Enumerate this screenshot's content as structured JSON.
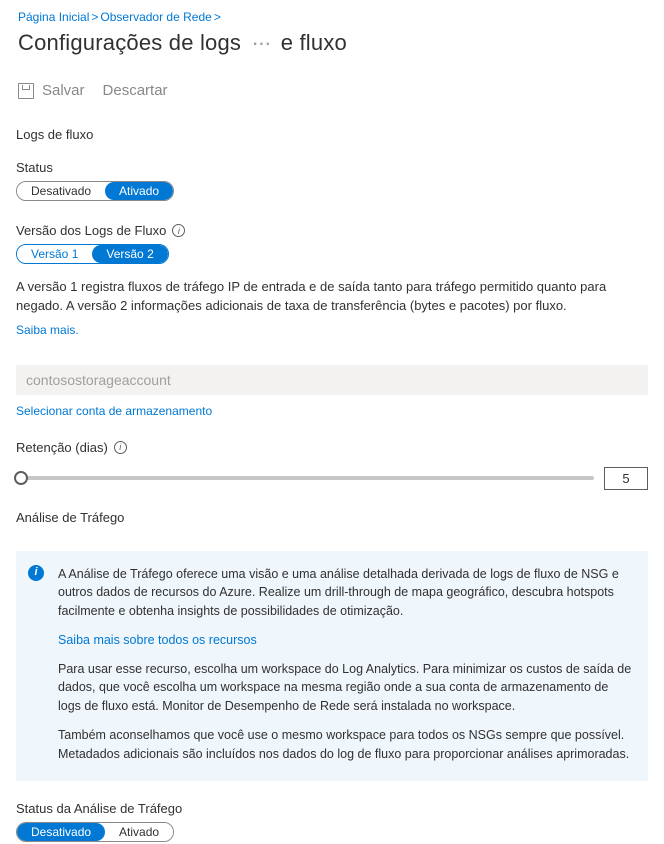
{
  "breadcrumb": {
    "home": "Página Inicial",
    "watcher": "Observador de Rede"
  },
  "pageTitle": {
    "prefix": "Configurações de logs",
    "suffix": "e fluxo"
  },
  "toolbar": {
    "save": "Salvar",
    "discard": "Descartar"
  },
  "sections": {
    "flowLogs": "Logs de fluxo",
    "trafficAnalysis": "Análise de Tráfego"
  },
  "status": {
    "label": "Status",
    "off": "Desativado",
    "on": "Ativado"
  },
  "version": {
    "label": "Versão dos Logs de Fluxo",
    "v1": "Versão 1",
    "v2": "Versão 2",
    "desc": "A versão 1 registra fluxos de tráfego IP de entrada e de saída tanto para tráfego permitido quanto para negado. A versão 2 informações adicionais de taxa de transferência (bytes e pacotes) por fluxo.",
    "learnMore": "Saiba mais."
  },
  "storage": {
    "value": "contosostorageaccount",
    "selectLink": "Selecionar conta de armazenamento"
  },
  "retention": {
    "label": "Retenção (dias)",
    "value": "5"
  },
  "trafficPanel": {
    "p1": "A Análise de Tráfego oferece uma visão e uma análise detalhada derivada de logs de fluxo de NSG e outros dados de recursos do Azure. Realize um drill-through de mapa geográfico, descubra hotspots facilmente e obtenha insights de possibilidades de otimização.",
    "link": "Saiba mais sobre todos os recursos",
    "p2": "Para usar esse recurso, escolha um workspace do Log Analytics. Para minimizar os custos de saída de dados, que você escolha um workspace na mesma região onde a sua conta de armazenamento de logs de fluxo está. Monitor de Desempenho de Rede será instalada no workspace.",
    "p3": "Também aconselhamos que você use o mesmo workspace para todos os NSGs sempre que possível. Metadados adicionais são incluídos nos dados do log de fluxo para proporcionar análises aprimoradas."
  },
  "trafficStatus": {
    "label": "Status da Análise de Tráfego",
    "off": "Desativado",
    "on": "Ativado"
  }
}
